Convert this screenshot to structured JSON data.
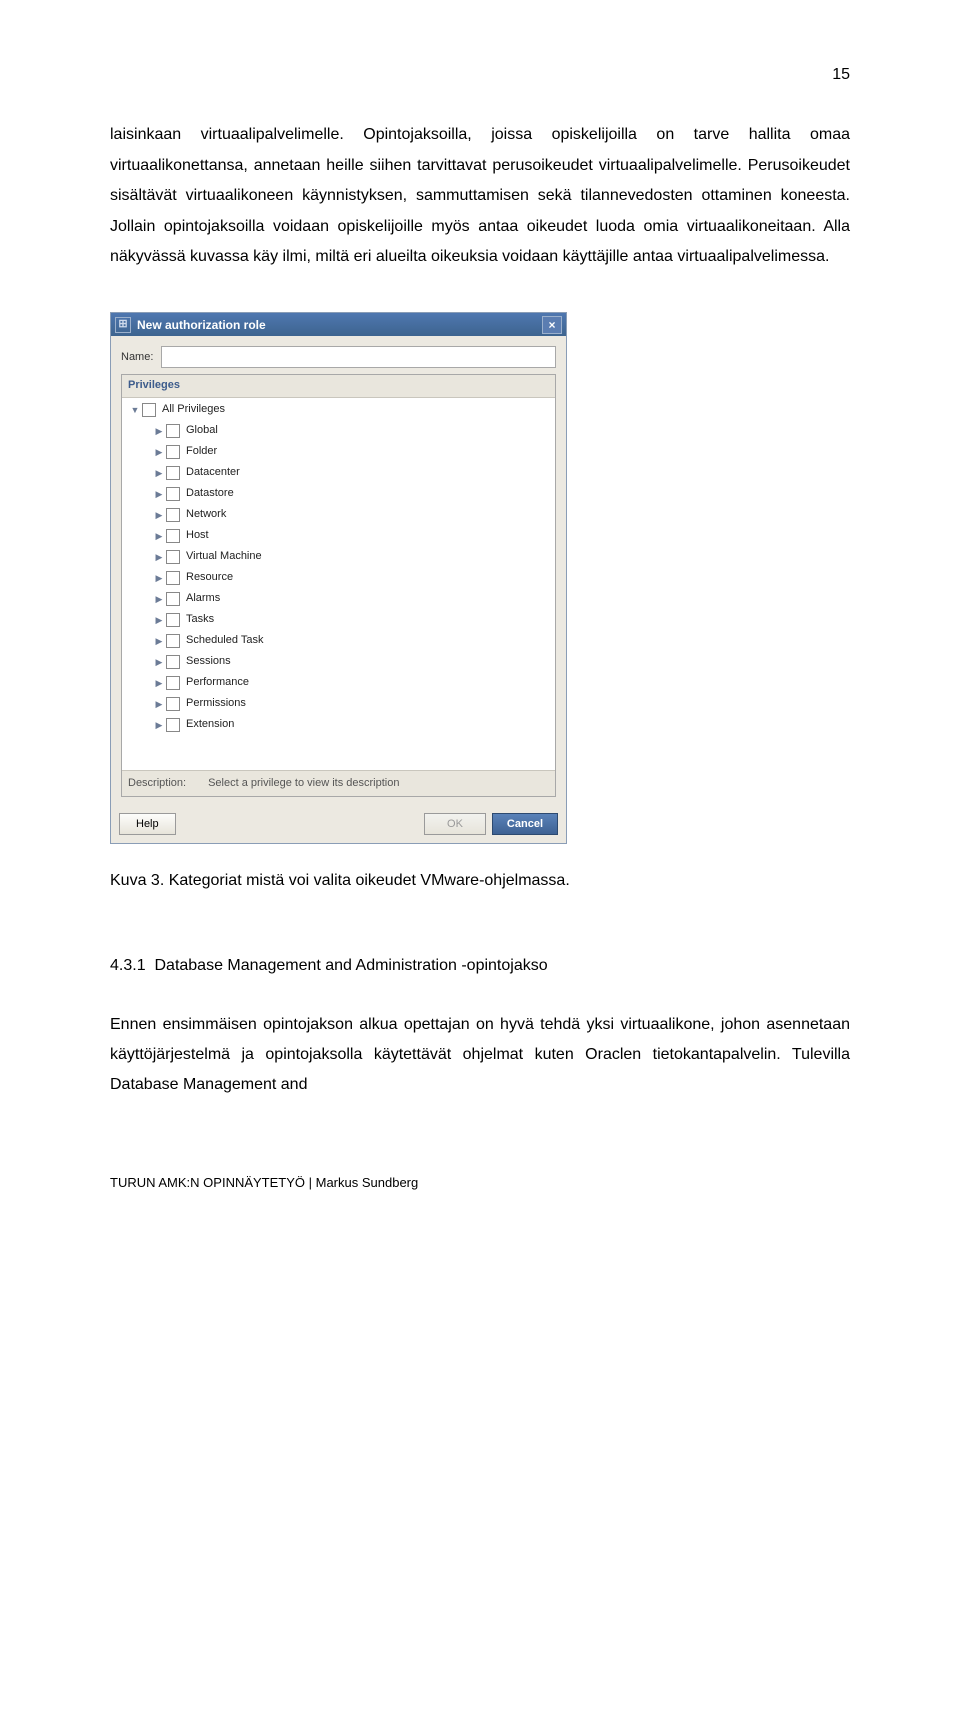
{
  "page_number": "15",
  "para1": "laisinkaan virtuaalipalvelimelle. Opintojaksoilla, joissa opiskelijoilla on tarve hallita omaa virtuaalikonettansa, annetaan heille siihen tarvittavat perusoikeudet virtuaalipalvelimelle. Perusoikeudet sisältävät virtuaalikoneen käynnistyksen, sammuttamisen sekä tilannevedosten ottaminen koneesta. Jollain opintojaksoilla voidaan opiskelijoille myös antaa oikeudet luoda omia virtuaalikoneitaan. Alla näkyvässä kuvassa käy ilmi, miltä eri alueilta oikeuksia voidaan käyttäjille antaa virtuaalipalvelimessa.",
  "dialog": {
    "title": "New authorization role",
    "name_label": "Name:",
    "name_value": "",
    "privileges_header": "Privileges",
    "desc_label": "Description:",
    "desc_value": "Select a privilege to view its description",
    "items": [
      {
        "label": "All Privileges",
        "dir": "down",
        "indent": 0
      },
      {
        "label": "Global",
        "dir": "right",
        "indent": 1
      },
      {
        "label": "Folder",
        "dir": "right",
        "indent": 1
      },
      {
        "label": "Datacenter",
        "dir": "right",
        "indent": 1
      },
      {
        "label": "Datastore",
        "dir": "right",
        "indent": 1
      },
      {
        "label": "Network",
        "dir": "right",
        "indent": 1
      },
      {
        "label": "Host",
        "dir": "right",
        "indent": 1
      },
      {
        "label": "Virtual Machine",
        "dir": "right",
        "indent": 1
      },
      {
        "label": "Resource",
        "dir": "right",
        "indent": 1
      },
      {
        "label": "Alarms",
        "dir": "right",
        "indent": 1
      },
      {
        "label": "Tasks",
        "dir": "right",
        "indent": 1
      },
      {
        "label": "Scheduled Task",
        "dir": "right",
        "indent": 1
      },
      {
        "label": "Sessions",
        "dir": "right",
        "indent": 1
      },
      {
        "label": "Performance",
        "dir": "right",
        "indent": 1
      },
      {
        "label": "Permissions",
        "dir": "right",
        "indent": 1
      },
      {
        "label": "Extension",
        "dir": "right",
        "indent": 1
      }
    ],
    "help_label": "Help",
    "ok_label": "OK",
    "cancel_label": "Cancel"
  },
  "caption": "Kuva 3. Kategoriat mistä voi valita oikeudet VMware-ohjelmassa.",
  "section_number": "4.3.1",
  "section_title": "Database Management and Administration -opintojakso",
  "para2": "Ennen ensimmäisen opintojakson alkua opettajan on hyvä tehdä yksi virtuaalikone, johon asennetaan käyttöjärjestelmä ja opintojaksolla käytettävät ohjelmat kuten Oraclen tietokantapalvelin. Tulevilla Database Management and",
  "footer": "TURUN AMK:N OPINNÄYTETYÖ | Markus Sundberg"
}
